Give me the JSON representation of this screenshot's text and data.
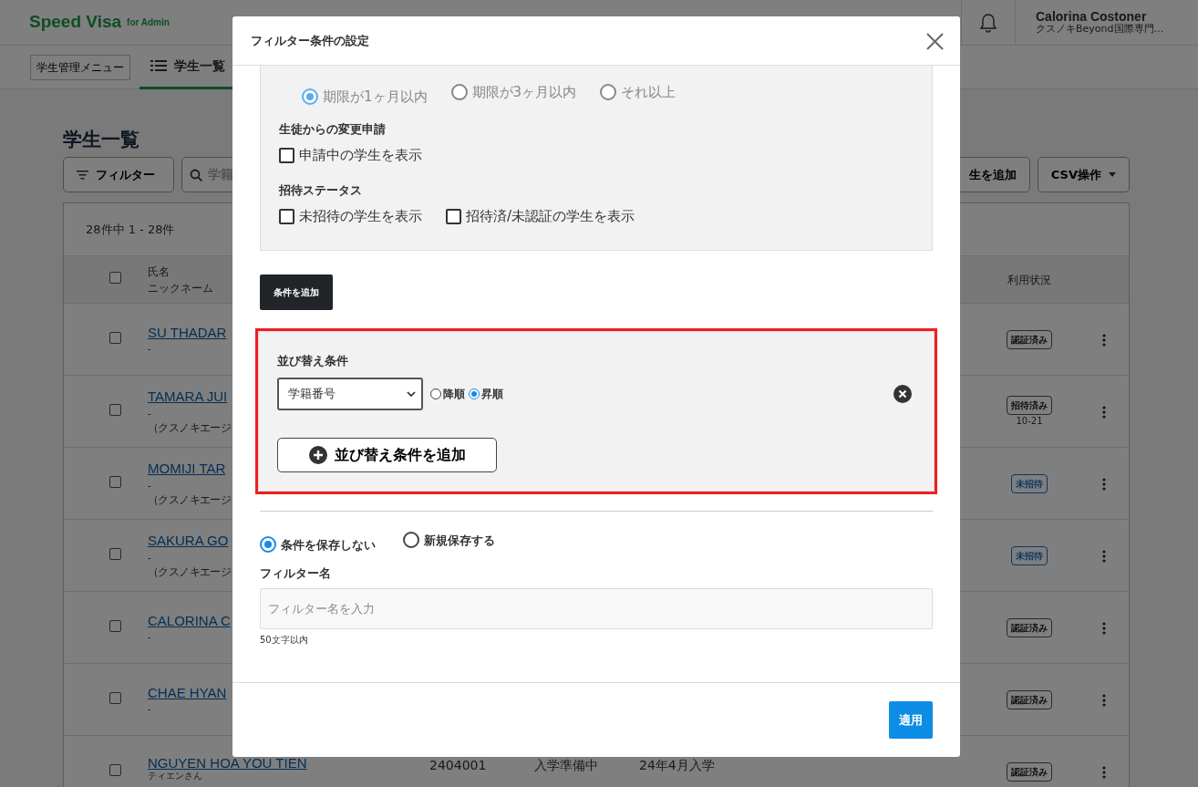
{
  "header": {
    "logo": "Speed Visa",
    "logo_sub": "for Admin",
    "user_name": "Calorina Costoner",
    "user_org": "クスノキBeyond国際専門…"
  },
  "subnav": {
    "menu_button": "学生管理メニュー",
    "tabs": [
      {
        "label": "学生一覧",
        "selected": true
      }
    ]
  },
  "page": {
    "title": "学生一覧",
    "filter_button": "フィルター",
    "search_placeholder": "学籍",
    "add_button": "生を追加",
    "csv_button": "CSV操作"
  },
  "table": {
    "count": "28件中 1 - 28件",
    "header_name": "氏名",
    "header_nickname": "ニックネーム",
    "header_usage": "利用状況",
    "select_all_checked": false,
    "rows": [
      {
        "checked": false,
        "name": "SU THADAR",
        "nickname": "-",
        "status": {
          "label": "認証済み",
          "kind": "verified"
        }
      },
      {
        "checked": false,
        "name": "TAMARA JUI",
        "nickname": "-",
        "agency": "（クスノキエージ",
        "status": {
          "label": "招待済み",
          "kind": "invited",
          "date": "10-21"
        }
      },
      {
        "checked": false,
        "name": "MOMIJI TAR",
        "nickname": "-",
        "agency": "（クスノキエージ",
        "status": {
          "label": "未招待",
          "kind": "uninvited"
        }
      },
      {
        "checked": false,
        "name": "SAKURA GO",
        "nickname": "-",
        "agency": "（クスノキエージ",
        "status": {
          "label": "未招待",
          "kind": "uninvited"
        }
      },
      {
        "checked": false,
        "name": "CALORINA C",
        "nickname": "-",
        "status": {
          "label": "認証済み",
          "kind": "verified"
        }
      },
      {
        "checked": false,
        "name": "CHAE HYAN",
        "nickname": "-",
        "status": {
          "label": "認証済み",
          "kind": "verified"
        }
      },
      {
        "checked": false,
        "name": "NGUYEN HOA YOU TIEN",
        "nickname": "ティエンさん",
        "student_id": "2404001",
        "enrollment": "入学準備中",
        "intake": "24年4月入学",
        "status": {
          "label": "認証済み",
          "kind": "verified"
        }
      }
    ]
  },
  "modal": {
    "title": "フィルター条件の設定",
    "expiry_disabled": true,
    "expiry_options": [
      {
        "label": "期限が1ヶ月以内",
        "selected": true
      },
      {
        "label": "期限が3ヶ月以内",
        "selected": false
      },
      {
        "label": "それ以上",
        "selected": false
      }
    ],
    "sections": [
      {
        "heading": "生徒からの変更申請",
        "checkboxes": [
          {
            "label": "申請中の学生を表示",
            "checked": false
          }
        ]
      },
      {
        "heading": "招待ステータス",
        "checkboxes": [
          {
            "label": "未招待の学生を表示",
            "checked": false
          },
          {
            "label": "招待済/未認証の学生を表示",
            "checked": false
          }
        ]
      }
    ],
    "add_condition_button": "条件を追加",
    "sort": {
      "highlighted": true,
      "heading": "並び替え条件",
      "field": "学籍番号",
      "orders": [
        {
          "label": "降順",
          "selected": false
        },
        {
          "label": "昇順",
          "selected": true
        }
      ],
      "add_button": "並び替え条件を追加"
    },
    "save_options": [
      {
        "label": "条件を保存しない",
        "selected": true
      },
      {
        "label": "新規保存する",
        "selected": false
      }
    ],
    "filter_name": {
      "label": "フィルター名",
      "placeholder": "フィルター名を入力",
      "help": "50文字以内"
    },
    "apply_button": "適用"
  }
}
